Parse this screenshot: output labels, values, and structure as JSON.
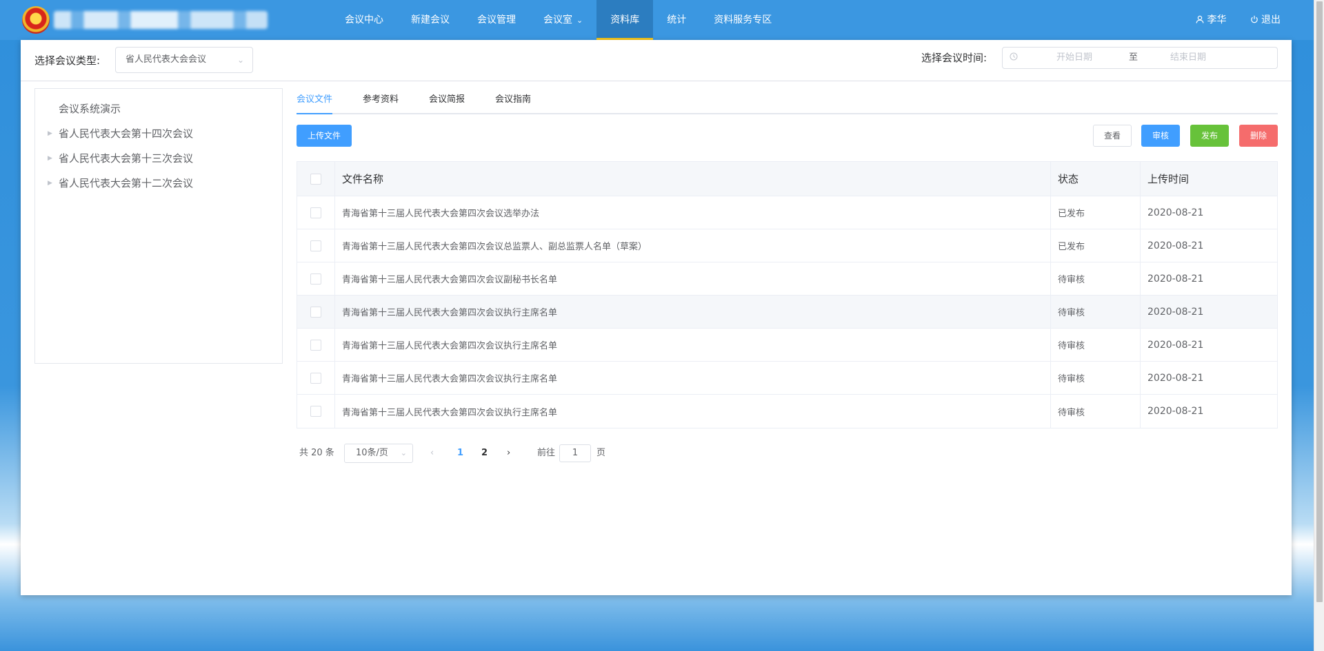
{
  "header": {
    "nav": [
      {
        "label": "会议中心"
      },
      {
        "label": "新建会议"
      },
      {
        "label": "会议管理"
      },
      {
        "label": "会议室"
      },
      {
        "label": "资料库"
      },
      {
        "label": "统计"
      },
      {
        "label": "资料服务专区"
      }
    ],
    "active_nav": "资料库",
    "user_name": "李华",
    "logout_label": "退出",
    "user_icon": "user-icon",
    "logout_icon": "power-icon"
  },
  "filters": {
    "type_label": "选择会议类型:",
    "type_value": "省人民代表大会会议",
    "time_label": "选择会议时间:",
    "start_placeholder": "开始日期",
    "range_separator": "至",
    "end_placeholder": "结束日期"
  },
  "tree": {
    "root": "会议系统演示",
    "items": [
      {
        "label": "省人民代表大会第十四次会议"
      },
      {
        "label": "省人民代表大会第十三次会议"
      },
      {
        "label": "省人民代表大会第十二次会议"
      }
    ]
  },
  "tabs": [
    {
      "label": "会议文件"
    },
    {
      "label": "参考资料"
    },
    {
      "label": "会议简报"
    },
    {
      "label": "会议指南"
    }
  ],
  "active_tab": "会议文件",
  "toolbar": {
    "upload_label": "上传文件",
    "view_label": "查看",
    "review_label": "审核",
    "publish_label": "发布",
    "delete_label": "删除"
  },
  "table": {
    "columns": [
      "文件名称",
      "状态",
      "上传时间"
    ],
    "rows": [
      {
        "name": "青海省第十三届人民代表大会第四次会议选举办法",
        "status": "已发布",
        "date": "2020-08-21"
      },
      {
        "name": "青海省第十三届人民代表大会第四次会议总监票人、副总监票人名单（草案）",
        "status": "已发布",
        "date": "2020-08-21"
      },
      {
        "name": "青海省第十三届人民代表大会第四次会议副秘书长名单",
        "status": "待审核",
        "date": "2020-08-21"
      },
      {
        "name": "青海省第十三届人民代表大会第四次会议执行主席名单",
        "status": "待审核",
        "date": "2020-08-21"
      },
      {
        "name": "青海省第十三届人民代表大会第四次会议执行主席名单",
        "status": "待审核",
        "date": "2020-08-21"
      },
      {
        "name": "青海省第十三届人民代表大会第四次会议执行主席名单",
        "status": "待审核",
        "date": "2020-08-21"
      },
      {
        "name": "青海省第十三届人民代表大会第四次会议执行主席名单",
        "status": "待审核",
        "date": "2020-08-21"
      }
    ]
  },
  "pagination": {
    "total_text": "共 20 条",
    "page_size": "10条/页",
    "pages": [
      "1",
      "2"
    ],
    "current_page": "1",
    "goto_prefix": "前往",
    "goto_value": "1",
    "goto_suffix": "页"
  },
  "colors": {
    "nav_bg": "#3b97e1",
    "primary": "#409eff",
    "success": "#67c23a",
    "danger": "#f56c6c",
    "active_underline": "#f3c51c"
  }
}
